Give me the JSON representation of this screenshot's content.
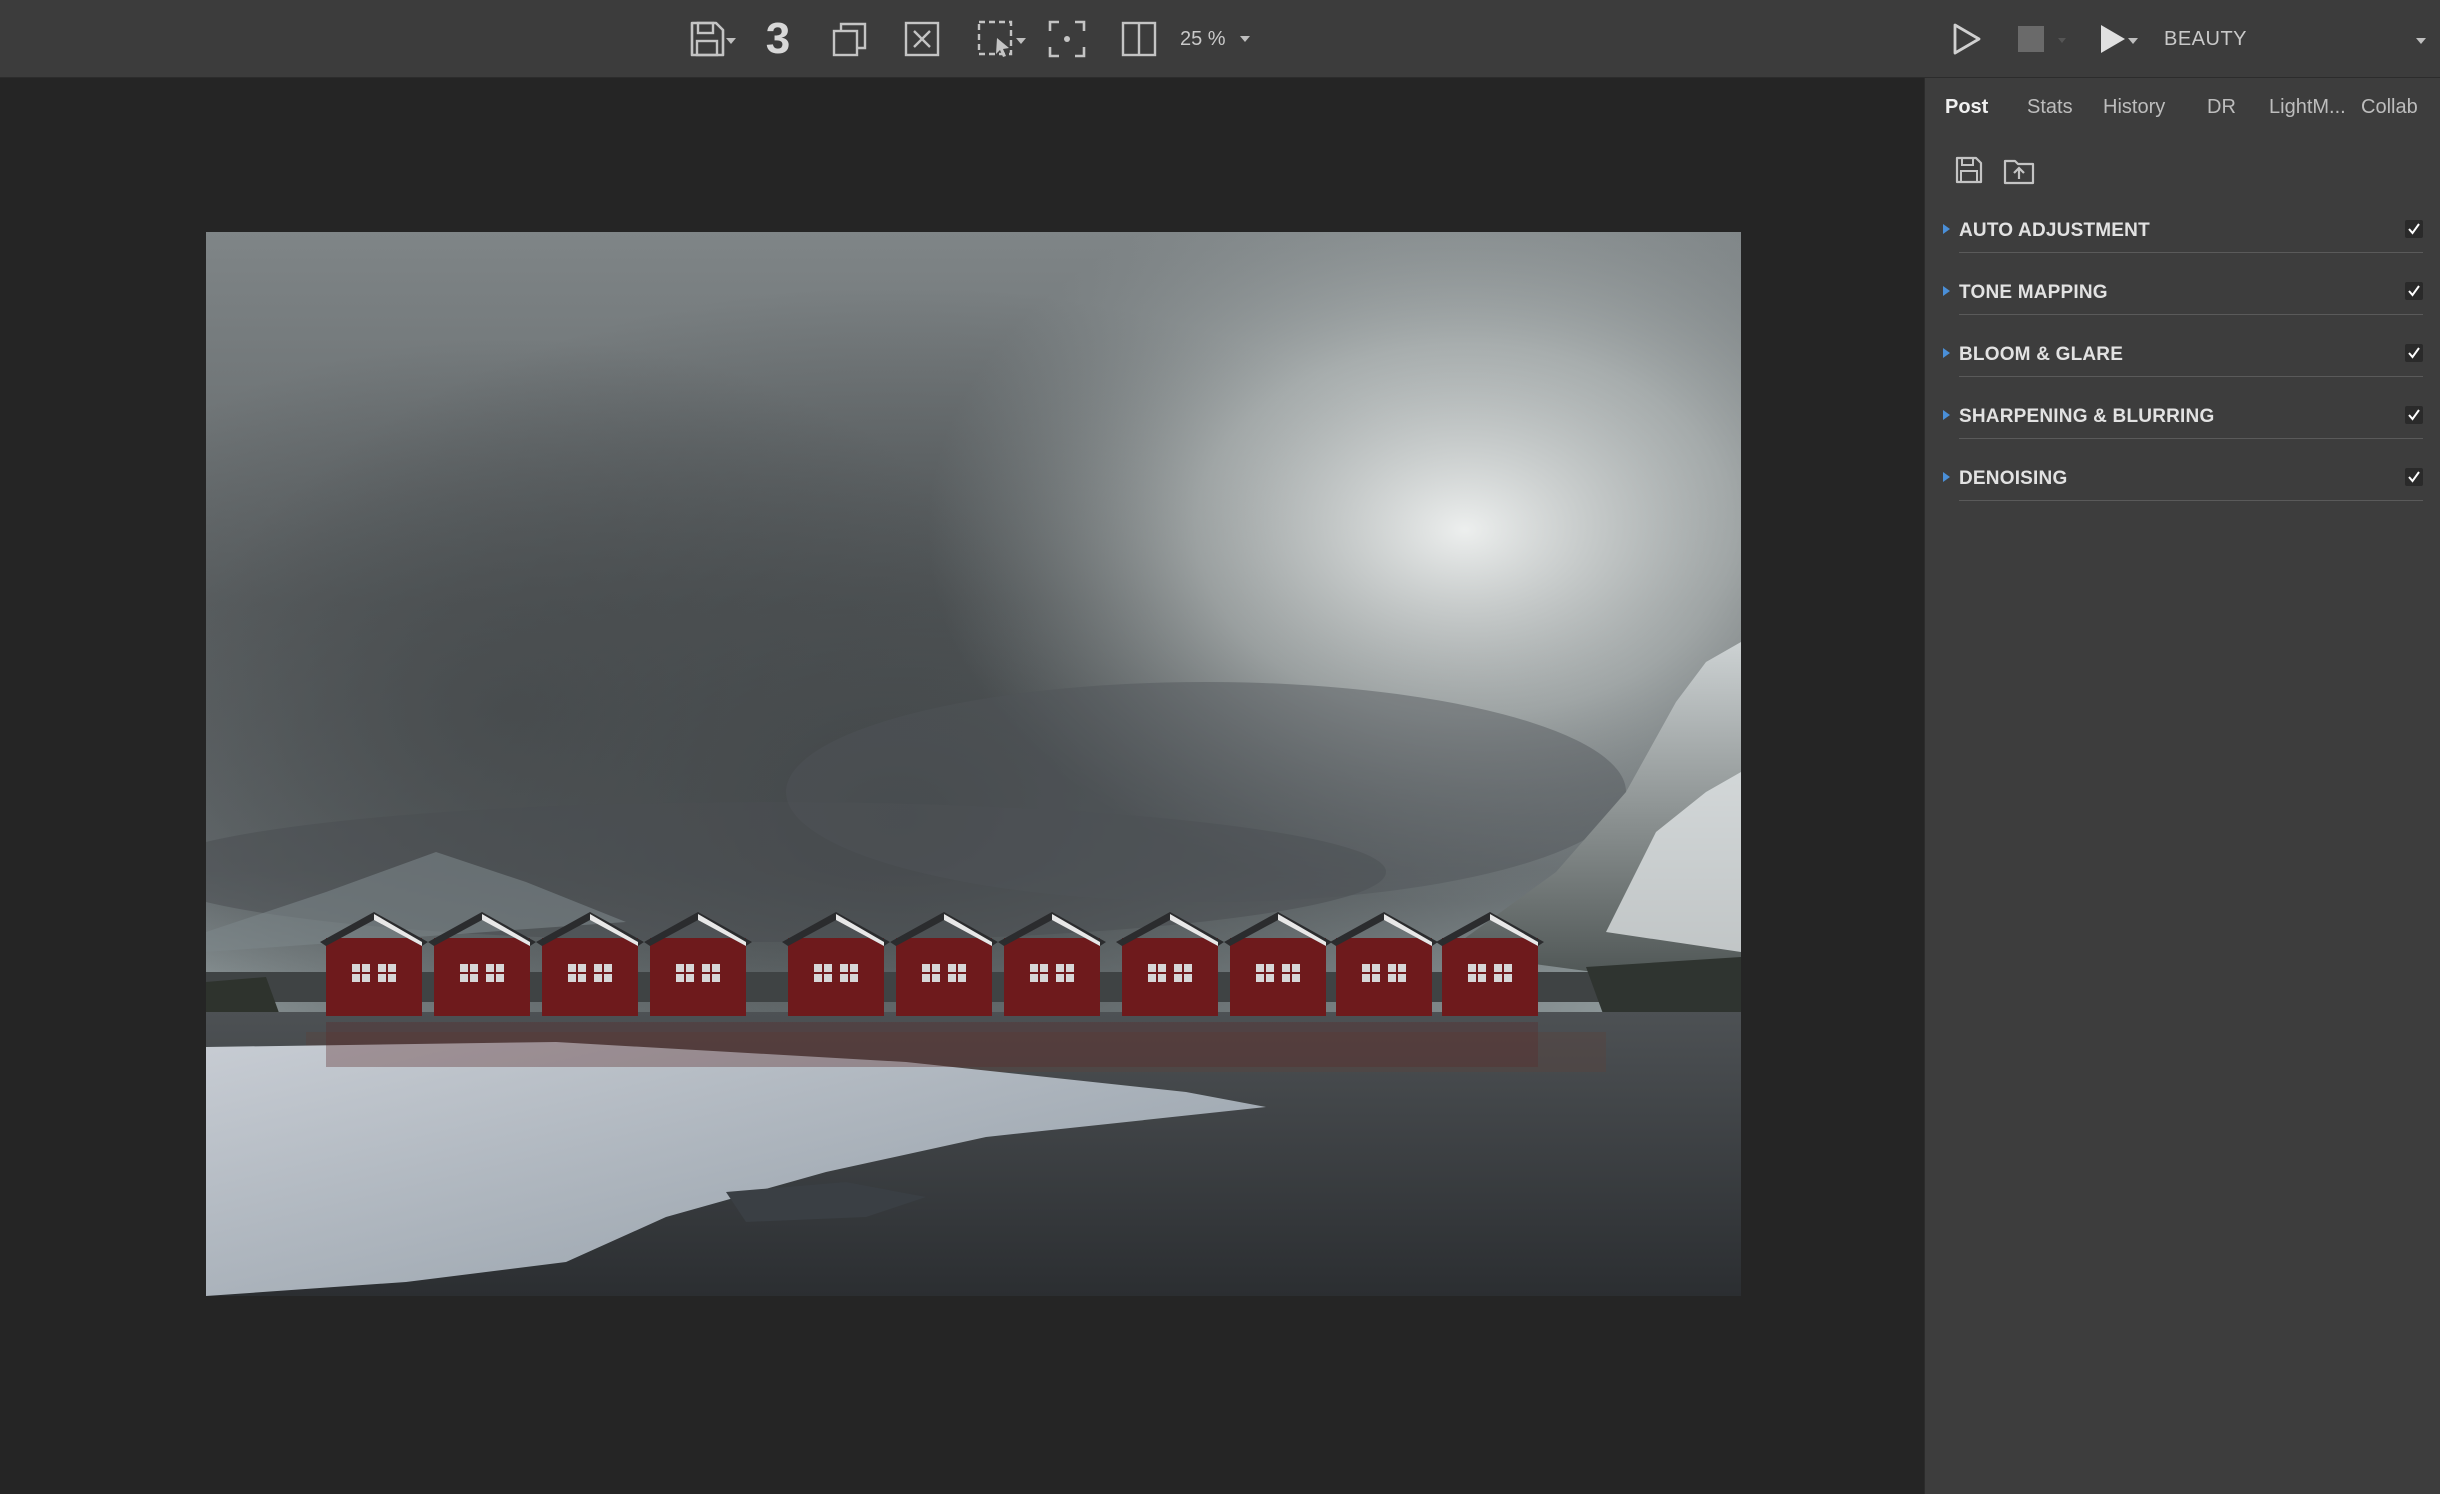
{
  "toolbar": {
    "render_count": "3",
    "zoom": "25 %",
    "channel": "BEAUTY"
  },
  "panel": {
    "tabs": [
      {
        "label": "Post",
        "active": true
      },
      {
        "label": "Stats",
        "active": false
      },
      {
        "label": "History",
        "active": false
      },
      {
        "label": "DR",
        "active": false
      },
      {
        "label": "LightM...",
        "active": false
      },
      {
        "label": "Collab",
        "active": false
      }
    ],
    "sections": [
      {
        "title": "AUTO ADJUSTMENT",
        "enabled": true
      },
      {
        "title": "TONE MAPPING",
        "enabled": true
      },
      {
        "title": "BLOOM & GLARE",
        "enabled": true
      },
      {
        "title": "SHARPENING & BLURRING",
        "enabled": true
      },
      {
        "title": "DENOISING",
        "enabled": true
      }
    ]
  },
  "colors": {
    "accent": "#4a8fd8",
    "toolbar_bg": "#3c3c3c",
    "panel_bg": "#3d3d3d",
    "viewport_bg": "#252525",
    "hut_red": "#6e1a1c"
  },
  "icons": {
    "save": "save-icon",
    "copy": "copy-icon",
    "clear": "clear-icon",
    "region": "region-render-icon",
    "focus": "focus-icon",
    "split": "compare-split-icon",
    "start": "start-render-icon",
    "stop": "stop-render-icon",
    "start_alt": "start-interactive-icon",
    "save_preset": "save-preset-icon",
    "load_preset": "load-preset-icon"
  }
}
